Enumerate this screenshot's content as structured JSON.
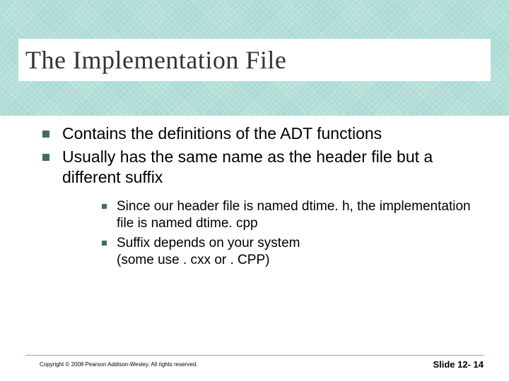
{
  "title": "The Implementation File",
  "bullets": [
    "Contains the definitions of the ADT functions",
    "Usually has the same name as the header file but a different suffix"
  ],
  "sub_bullets": [
    "Since our header file is named dtime. h,  the implementation file is named dtime. cpp",
    "Suffix depends on your system\n(some use . cxx or . CPP)"
  ],
  "footer": {
    "copyright": "Copyright © 2008 Pearson Addison-Wesley.  All rights reserved.",
    "slide": "Slide 12- 14"
  }
}
